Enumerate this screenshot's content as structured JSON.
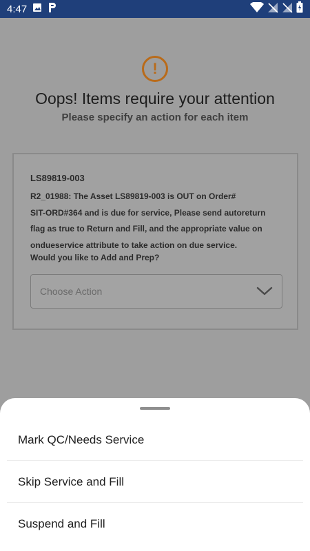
{
  "status_bar": {
    "time": "4:47",
    "left_icons": [
      "image-icon",
      "p-app-icon"
    ],
    "right_icons": [
      "wifi-icon",
      "no-signal-icon",
      "no-signal-icon",
      "battery-icon"
    ]
  },
  "alert": {
    "icon": "exclamation-circle-icon",
    "icon_glyph": "!",
    "color": "#b96b1a",
    "title": "Oops! Items require your attention",
    "subtitle": "Please specify an action for each item"
  },
  "item_card": {
    "asset_id": "LS89819-003",
    "message_lines": [
      "R2_01988: The Asset LS89819-003 is OUT on Order#",
      "SIT-ORD#364 and is due for service, Please send autoreturn",
      "flag as true to Return and Fill, and the appropriate value on",
      "ondueservice attribute to take action on due service."
    ],
    "question": "Would you like to Add and Prep?",
    "select": {
      "placeholder": "Choose Action",
      "icon": "chevron-down-icon"
    }
  },
  "bottom_sheet": {
    "options": [
      "Mark QC/Needs Service",
      "Skip Service and Fill",
      "Suspend and Fill"
    ]
  },
  "colors": {
    "status_bar": "#1f3f7a",
    "overlay_background": "#9e9e9e",
    "sheet_background": "#ffffff"
  }
}
